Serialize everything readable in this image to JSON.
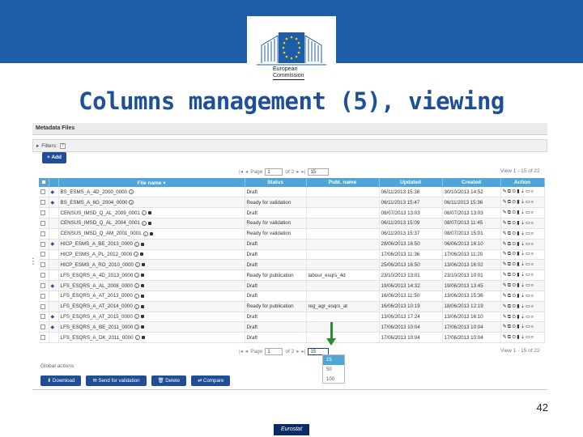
{
  "logo": {
    "line1": "European",
    "line2": "Commission"
  },
  "slide": {
    "title": "Columns management (5), viewing",
    "page_number": "42",
    "footer": "Eurostat"
  },
  "app": {
    "panel_title": "Metadata Files",
    "filters_label": "Filters:",
    "filters_help": "?",
    "add_label": "Add",
    "pager_top": {
      "page_label": "Page",
      "page_value": "1",
      "of_label": "of 2",
      "page_size": "15",
      "view_info": "View 1 - 15 of 22"
    },
    "pager_bottom": {
      "page_label": "Page",
      "page_value": "1",
      "of_label": "of 2",
      "page_size": "15",
      "view_info": "View 1 - 15 of 22"
    },
    "columns": [
      "File name",
      "Status",
      "Publ. name",
      "Updated",
      "Created",
      "Action"
    ],
    "rows": [
      {
        "file": "BS_ESMS_A_4D_2000_0000",
        "status": "Draft",
        "publ": "",
        "updated": "06/11/2013 15:38",
        "created": "30/10/2013 14:52"
      },
      {
        "file": "BS_ESMS_A_6G_2004_0000",
        "status": "Ready for validation",
        "publ": "",
        "updated": "06/11/2013 15:47",
        "created": "06/11/2013 15:36"
      },
      {
        "file": "CENSUS_IMSD_Q_AL_2009_0001",
        "status": "Draft",
        "publ": "",
        "updated": "08/07/2013 13:03",
        "created": "08/07/2013 13:03"
      },
      {
        "file": "CENSUS_IMSD_Q_AL_2004_0001",
        "status": "Ready for validation",
        "publ": "",
        "updated": "06/11/2013 15:09",
        "created": "08/07/2013 11:45"
      },
      {
        "file": "CENSUS_IMSD_Q_AM_2001_0001",
        "status": "Ready for validation",
        "publ": "",
        "updated": "06/11/2013 15:37",
        "created": "08/07/2013 15:01"
      },
      {
        "file": "HICP_ESMS_A_BE_2013_0000",
        "status": "Draft",
        "publ": "",
        "updated": "28/06/2013 16:50",
        "created": "06/06/2013 16:10"
      },
      {
        "file": "HICP_ESMS_A_PL_2012_0000",
        "status": "Draft",
        "publ": "",
        "updated": "17/06/2013 11:36",
        "created": "17/06/2013 11:20"
      },
      {
        "file": "HICP_ESMS_A_RO_2010_0000",
        "status": "Draft",
        "publ": "",
        "updated": "25/06/2013 16:50",
        "created": "13/06/2013 16:02"
      },
      {
        "file": "LFS_ESQRS_A_4D_2013_0000",
        "status": "Ready for publication",
        "publ": "labour_esqrs_4d",
        "updated": "23/10/2013 13:01",
        "created": "23/10/2013 10:01"
      },
      {
        "file": "LFS_ESQRS_A_AL_2008_0000",
        "status": "Draft",
        "publ": "",
        "updated": "19/06/2013 14:32",
        "created": "19/06/2013 13:45"
      },
      {
        "file": "LFS_ESQRS_A_AT_2013_0000",
        "status": "Draft",
        "publ": "",
        "updated": "16/06/2013 11:50",
        "created": "13/06/2013 15:36"
      },
      {
        "file": "LFS_ESQRS_A_AT_2014_0000",
        "status": "Ready for publication",
        "publ": "reg_agr_esqrs_at",
        "updated": "16/06/2013 10:19",
        "created": "18/06/2013 12:19"
      },
      {
        "file": "LFS_ESQRS_A_AT_2015_0000",
        "status": "Draft",
        "publ": "",
        "updated": "13/06/2013 17:24",
        "created": "13/06/2013 16:10"
      },
      {
        "file": "LFS_ESQRS_A_BE_2011_0000",
        "status": "Draft",
        "publ": "",
        "updated": "17/06/2013 10:04",
        "created": "17/06/2013 10:04"
      },
      {
        "file": "LFS_ESQRS_A_DK_2011_0000",
        "status": "Draft",
        "publ": "",
        "updated": "17/06/2013 10:04",
        "created": "17/06/2013 10:04"
      }
    ],
    "page_size_options": [
      "15",
      "50",
      "100"
    ],
    "global_actions_label": "Global actions",
    "global_actions": [
      "Download",
      "Send for validation",
      "Delete",
      "Compare"
    ],
    "colors": {
      "header_band": "#1e5ea8",
      "grid_header": "#4fa4d8",
      "button": "#1f4e96",
      "arrow": "#2f8a2f",
      "title": "#1e4f99"
    }
  }
}
